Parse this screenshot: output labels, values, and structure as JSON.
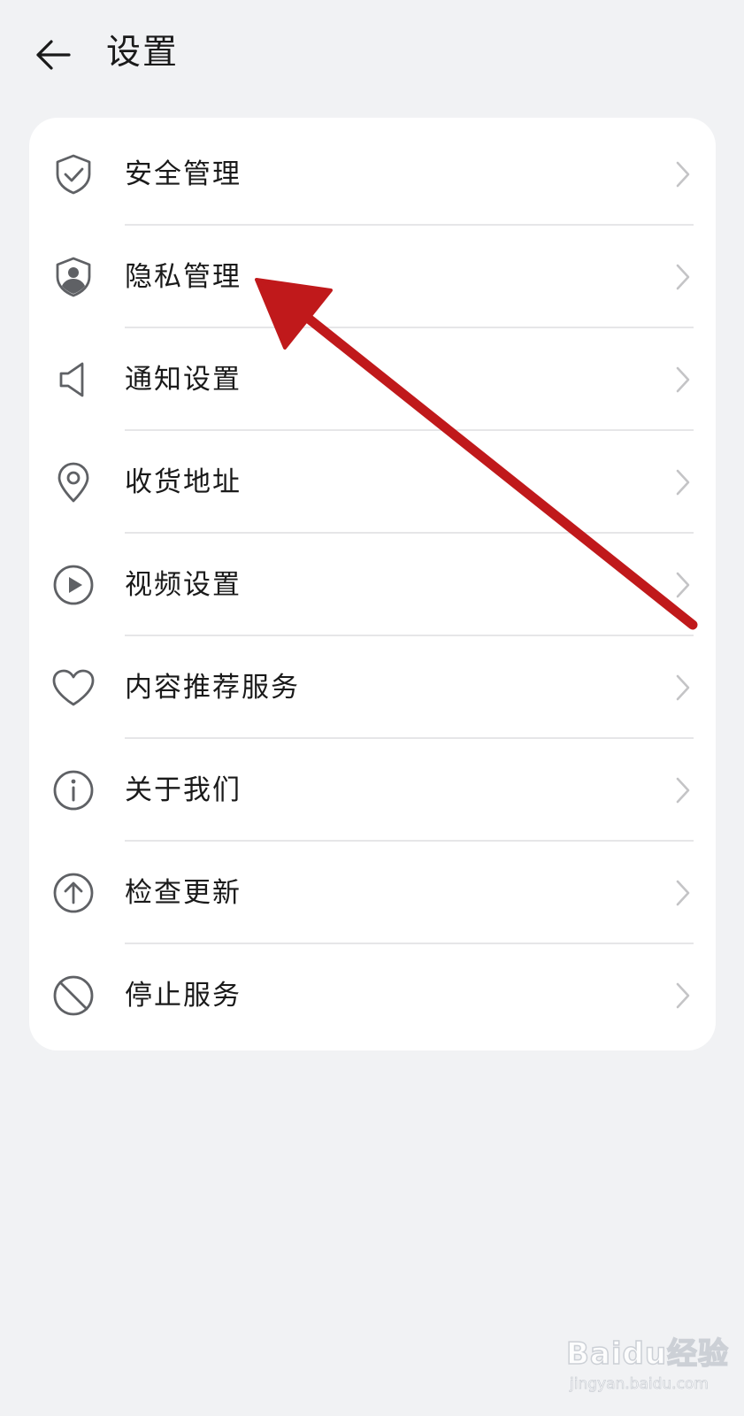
{
  "header": {
    "title": "设置",
    "back_icon": "arrow-left-icon"
  },
  "menu": {
    "items": [
      {
        "label": "安全管理",
        "icon": "shield-check-icon"
      },
      {
        "label": "隐私管理",
        "icon": "shield-user-icon"
      },
      {
        "label": "通知设置",
        "icon": "speaker-icon"
      },
      {
        "label": "收货地址",
        "icon": "location-pin-icon"
      },
      {
        "label": "视频设置",
        "icon": "play-circle-icon"
      },
      {
        "label": "内容推荐服务",
        "icon": "heart-icon"
      },
      {
        "label": "关于我们",
        "icon": "info-icon"
      },
      {
        "label": "检查更新",
        "icon": "arrow-up-circle-icon"
      },
      {
        "label": "停止服务",
        "icon": "prohibited-icon"
      }
    ],
    "chevron_icon": "chevron-right-icon"
  },
  "annotation": {
    "arrow_color": "#c0191b",
    "points_to": "隐私管理"
  },
  "watermark": {
    "main": "Baidu经验",
    "sub": "jingyan.baidu.com"
  },
  "colors": {
    "background": "#f1f2f4",
    "card": "#ffffff",
    "icon": "#5f6165",
    "chevron": "#c4c4c6",
    "divider": "#e6e6e8"
  }
}
